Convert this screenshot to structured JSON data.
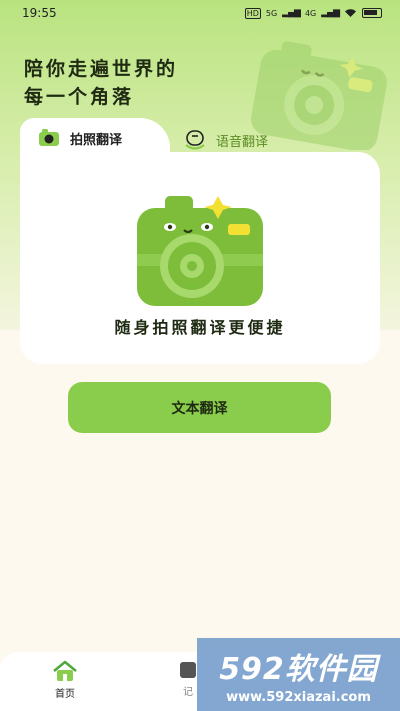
{
  "status_bar": {
    "time": "19:55",
    "net_hd": "HD",
    "net_5g": "5G",
    "net_4g": "4G",
    "wifi_icon": "wifi-icon",
    "battery_icon": "battery-icon"
  },
  "headline": {
    "line1": "陪你走遍世界的",
    "line2": "每一个角落"
  },
  "tabs": [
    {
      "label": "拍照翻译",
      "icon": "camera-icon",
      "active": true
    },
    {
      "label": "语音翻译",
      "icon": "voice-face-icon",
      "active": false
    }
  ],
  "card": {
    "caption": "随身拍照翻译更便捷",
    "illustration": "camera-mascot-icon"
  },
  "text_translate": {
    "label": "文本翻译"
  },
  "bottom_nav": [
    {
      "label": "首页",
      "icon": "home-icon"
    },
    {
      "label": "记",
      "icon": "notebook-icon"
    }
  ],
  "watermark": {
    "title": "592软件园",
    "url": "www.592xiazai.com"
  },
  "colors": {
    "accent": "#8ACD4C",
    "header_bg": "#B9E37F",
    "page_bg": "#FDF9EE"
  }
}
